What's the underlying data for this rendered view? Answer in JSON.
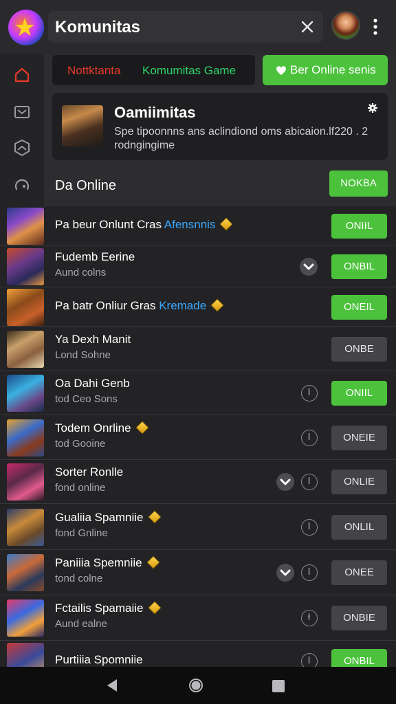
{
  "topbar": {
    "title": "Komunitas"
  },
  "tabs": {
    "red_label": "Nottktanta",
    "green_label": "Komumitas Game",
    "online_button": "Ber Online senis"
  },
  "info_card": {
    "title": "Oamiimitas",
    "description": "Spe tipoonnns ans aclindiond oms abicaion.lf220 . 2 rodngingime"
  },
  "section": {
    "title": "Da Online",
    "button": "NOKBA"
  },
  "list": [
    {
      "title": "Pa beur Onlunt Cras",
      "accent": "Afensnnis",
      "subtitle": "",
      "button": "ONIIL",
      "button_style": "green",
      "diamond": true,
      "chevron": false,
      "info": ""
    },
    {
      "title": "Fudemb Eerine",
      "accent": "",
      "subtitle": "Aund colns",
      "button": "ONBIL",
      "button_style": "green",
      "diamond": false,
      "chevron": true,
      "info": ""
    },
    {
      "title": "Pa batr Onliur Gras",
      "accent": "Kremade",
      "subtitle": "",
      "button": "ONEIL",
      "button_style": "green",
      "diamond": true,
      "chevron": false,
      "info": ""
    },
    {
      "title": "Ya Dexh Manit",
      "accent": "",
      "subtitle": "Lond Sohne",
      "button": "ONBE",
      "button_style": "gray",
      "diamond": false,
      "chevron": false,
      "info": ""
    },
    {
      "title": "Oa Dahi Genb",
      "accent": "",
      "subtitle": "tod Ceo Sons",
      "button": "ONIIL",
      "button_style": "green",
      "diamond": false,
      "chevron": false,
      "info": "I"
    },
    {
      "title": "Todem Onrline",
      "accent": "",
      "subtitle": "tod Gooine",
      "button": "ONEIE",
      "button_style": "gray",
      "diamond": true,
      "chevron": false,
      "info": "I"
    },
    {
      "title": "Sorter Ronlle",
      "accent": "",
      "subtitle": "fond online",
      "button": "ONLIE",
      "button_style": "gray",
      "diamond": false,
      "chevron": true,
      "info": "I"
    },
    {
      "title": "Gualiia Spamniie",
      "accent": "",
      "subtitle": "fond Gnline",
      "button": "ONLIL",
      "button_style": "gray",
      "diamond": true,
      "chevron": false,
      "info": "I"
    },
    {
      "title": "Paniiia Spemniie",
      "accent": "",
      "subtitle": "tond colne",
      "button": "ONEE",
      "button_style": "gray",
      "diamond": true,
      "chevron": true,
      "info": "I"
    },
    {
      "title": "Fctailis Spamaiie",
      "accent": "",
      "subtitle": "Aund ealne",
      "button": "ONBIE",
      "button_style": "gray",
      "diamond": true,
      "chevron": false,
      "info": "ł"
    },
    {
      "title": "Purtiiia Spomniie",
      "accent": "",
      "subtitle": "",
      "button": "ONBIL",
      "button_style": "green",
      "diamond": false,
      "chevron": false,
      "info": "I"
    }
  ],
  "colors": {
    "green": "#4cc23c",
    "red_text": "#e8392a",
    "green_text": "#2fd46a",
    "accent_blue": "#3aa7ff"
  },
  "icons": {
    "sidebar": [
      "home-icon",
      "mail-icon",
      "shield-icon",
      "game-icon"
    ],
    "navigation": [
      "back-icon",
      "home-button-icon",
      "recent-apps-icon"
    ]
  }
}
